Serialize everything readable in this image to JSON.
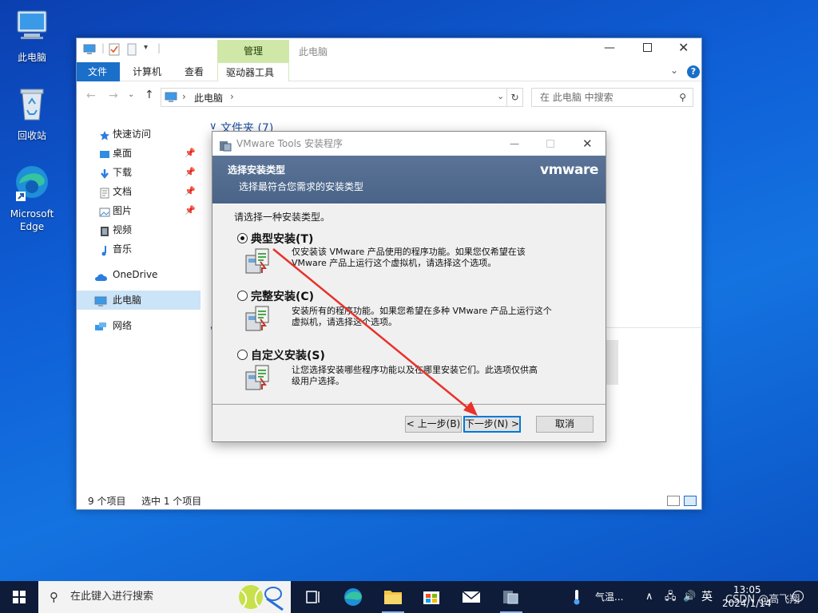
{
  "desktop": {
    "icons": [
      {
        "label": "此电脑"
      },
      {
        "label": "回收站"
      },
      {
        "label": "Microsoft Edge",
        "line1": "Microsoft",
        "line2": "Edge"
      }
    ]
  },
  "explorer": {
    "title": "此电脑",
    "manage_tab": "管理",
    "tabs": [
      "文件",
      "计算机",
      "查看",
      "驱动器工具"
    ],
    "address": "此电脑",
    "search_placeholder": "在 此电脑 中搜索",
    "section_header": "文件夹 (7)",
    "nav": {
      "quick_access": "快速访问",
      "items": [
        {
          "label": "桌面",
          "pinned": true
        },
        {
          "label": "下载",
          "pinned": true
        },
        {
          "label": "文档",
          "pinned": true
        },
        {
          "label": "图片",
          "pinned": true
        },
        {
          "label": "视频",
          "pinned": false
        },
        {
          "label": "音乐",
          "pinned": false
        }
      ],
      "onedrive": "OneDrive",
      "this_pc": "此电脑",
      "network": "网络"
    },
    "status": {
      "count": "9 个项目",
      "selected": "选中 1 个项目"
    }
  },
  "dialog": {
    "title": "VMware Tools 安装程序",
    "header_title": "选择安装类型",
    "header_subtitle": "选择最符合您需求的安装类型",
    "brand": "vmware",
    "prompt": "请选择一种安装类型。",
    "options": [
      {
        "label": "典型安装(T)",
        "selected": true,
        "desc1": "仅安装该 VMware 产品使用的程序功能。如果您仅希望在该",
        "desc2": "VMware 产品上运行这个虚拟机，请选择这个选项。"
      },
      {
        "label": "完整安装(C)",
        "selected": false,
        "desc1": "安装所有的程序功能。如果您希望在多种 VMware 产品上运行这个",
        "desc2": "虚拟机，请选择这个选项。"
      },
      {
        "label": "自定义安装(S)",
        "selected": false,
        "desc1": "让您选择安装哪些程序功能以及在哪里安装它们。此选项仅供高",
        "desc2": "级用户选择。"
      }
    ],
    "buttons": {
      "back": "< 上一步(B)",
      "next": "下一步(N) >",
      "cancel": "取消"
    }
  },
  "taskbar": {
    "search_placeholder": "在此键入进行搜索",
    "weather": "气温...",
    "ime": "英",
    "time": "13:05",
    "date": "2024/1/14",
    "watermark": "CSDN @高飞翔"
  },
  "colors": {
    "accent": "#1a6fc9",
    "manage_tab": "#cfe8a8",
    "dialog_header": "#4f6a8f",
    "arrow": "#e8322b"
  }
}
